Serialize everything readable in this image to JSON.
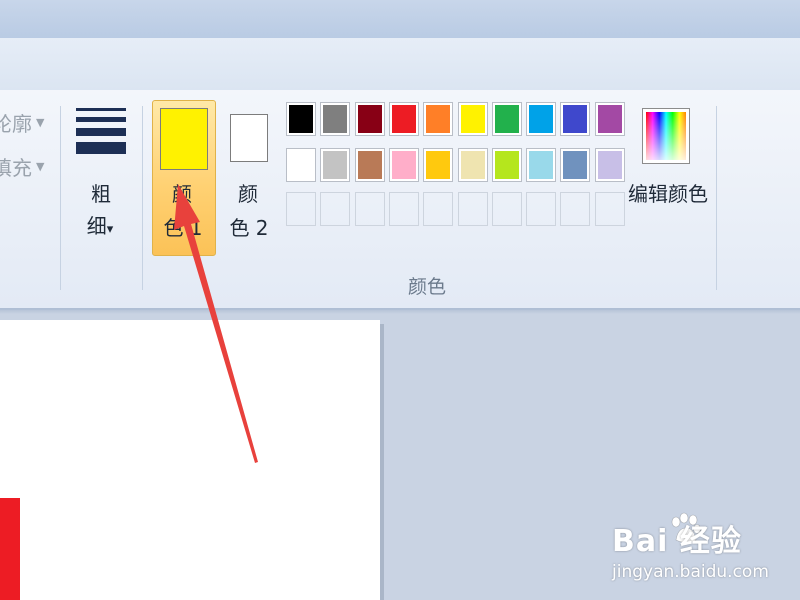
{
  "ribbon": {
    "outline_label": "轮廓",
    "fill_label": "填充",
    "size": {
      "line1": "粗",
      "line2": "细",
      "arrow": "▾"
    },
    "color1": {
      "line1": "颜",
      "line2": "色 1",
      "color": "#fff200"
    },
    "color2": {
      "line1": "颜",
      "line2": "色 2",
      "color": "#ffffff"
    },
    "palette_row1": [
      "#000000",
      "#7f7f7f",
      "#880015",
      "#ed1c24",
      "#ff7f27",
      "#fff200",
      "#22b14c",
      "#00a2e8",
      "#3f48cc",
      "#a349a4"
    ],
    "palette_row2": [
      "#ffffff",
      "#c3c3c3",
      "#b97a57",
      "#ffaec9",
      "#ffc90e",
      "#efe4b0",
      "#b5e61d",
      "#99d9ea",
      "#7092be",
      "#c8bfe7"
    ],
    "palette_row3_count": 10,
    "group_label": "颜色",
    "edit_colors_label": "编辑颜色"
  },
  "canvas": {
    "background": "#ffffff",
    "stroke_color": "#ed1c24"
  },
  "annotation": {
    "arrow_color": "#e8413c"
  },
  "watermark": {
    "brand": "Bai  经验",
    "sub": "jingyan.baidu.com"
  }
}
